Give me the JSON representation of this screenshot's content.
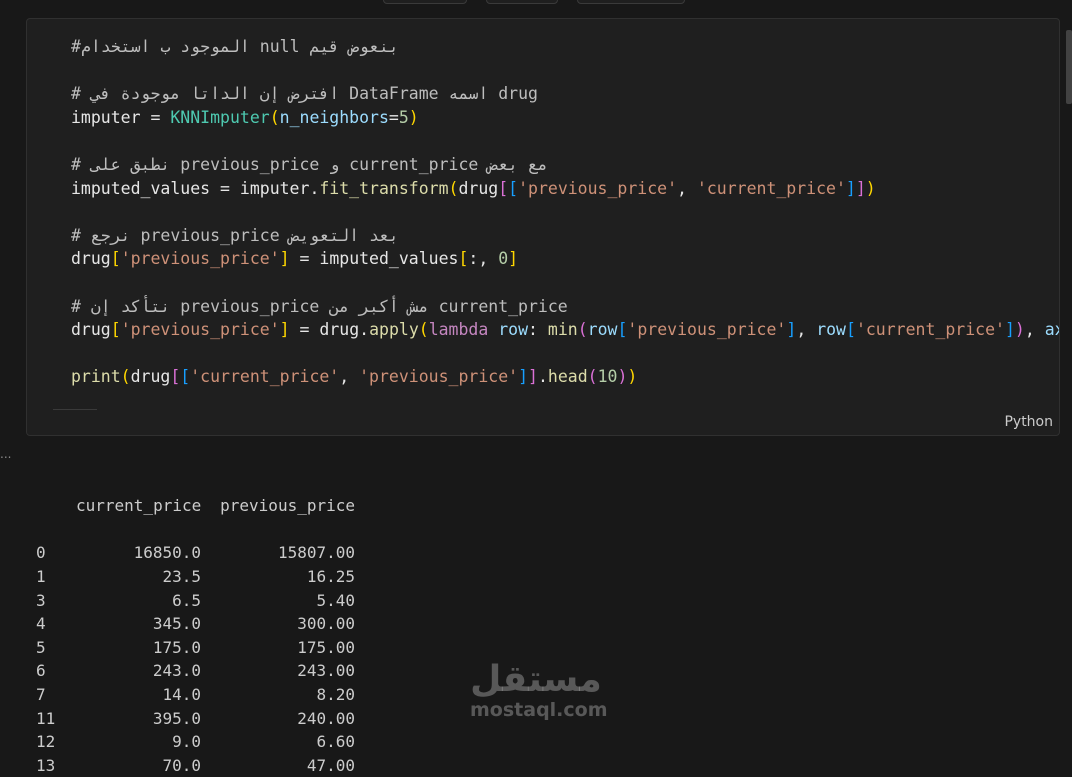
{
  "cell": {
    "language": "Python",
    "code_lines": [
      [
        {
          "t": "#الموجود ب استخدام null بنعوض قيم",
          "c": "cm"
        }
      ],
      [],
      [
        {
          "t": "# افترض إن الداتا موجودة في DataFrame اسمه drug",
          "c": "cm"
        }
      ],
      [
        {
          "t": "imputer",
          "c": "var"
        },
        {
          "t": " = ",
          "c": "var"
        },
        {
          "t": "KNNImputer",
          "c": "cls"
        },
        {
          "t": "(",
          "c": "b1"
        },
        {
          "t": "n_neighbors",
          "c": "par"
        },
        {
          "t": "=",
          "c": "var"
        },
        {
          "t": "5",
          "c": "num"
        },
        {
          "t": ")",
          "c": "b1"
        }
      ],
      [],
      [
        {
          "t": "# نطبق على previous_price و current_price مع بعض",
          "c": "cm"
        }
      ],
      [
        {
          "t": "imputed_values",
          "c": "var"
        },
        {
          "t": " = ",
          "c": "var"
        },
        {
          "t": "imputer",
          "c": "var"
        },
        {
          "t": ".",
          "c": "var"
        },
        {
          "t": "fit_transform",
          "c": "fn"
        },
        {
          "t": "(",
          "c": "b1"
        },
        {
          "t": "drug",
          "c": "var"
        },
        {
          "t": "[",
          "c": "b2"
        },
        {
          "t": "[",
          "c": "b3"
        },
        {
          "t": "'previous_price'",
          "c": "str"
        },
        {
          "t": ", ",
          "c": "var"
        },
        {
          "t": "'current_price'",
          "c": "str"
        },
        {
          "t": "]",
          "c": "b3"
        },
        {
          "t": "]",
          "c": "b2"
        },
        {
          "t": ")",
          "c": "b1"
        }
      ],
      [],
      [
        {
          "t": "# نرجع previous_price بعد التعويض",
          "c": "cm"
        }
      ],
      [
        {
          "t": "drug",
          "c": "var"
        },
        {
          "t": "[",
          "c": "b1"
        },
        {
          "t": "'previous_price'",
          "c": "str"
        },
        {
          "t": "]",
          "c": "b1"
        },
        {
          "t": " = ",
          "c": "var"
        },
        {
          "t": "imputed_values",
          "c": "var"
        },
        {
          "t": "[",
          "c": "b1"
        },
        {
          "t": ":, ",
          "c": "var"
        },
        {
          "t": "0",
          "c": "num"
        },
        {
          "t": "]",
          "c": "b1"
        }
      ],
      [],
      [
        {
          "t": "# نتأكد إن previous_price مش أكبر من current_price",
          "c": "cm"
        }
      ],
      [
        {
          "t": "drug",
          "c": "var"
        },
        {
          "t": "[",
          "c": "b1"
        },
        {
          "t": "'previous_price'",
          "c": "str"
        },
        {
          "t": "]",
          "c": "b1"
        },
        {
          "t": " = ",
          "c": "var"
        },
        {
          "t": "drug",
          "c": "var"
        },
        {
          "t": ".",
          "c": "var"
        },
        {
          "t": "apply",
          "c": "fn"
        },
        {
          "t": "(",
          "c": "b1"
        },
        {
          "t": "lambda",
          "c": "kw"
        },
        {
          "t": " ",
          "c": "var"
        },
        {
          "t": "row",
          "c": "par"
        },
        {
          "t": ": ",
          "c": "var"
        },
        {
          "t": "min",
          "c": "fn"
        },
        {
          "t": "(",
          "c": "b2"
        },
        {
          "t": "row",
          "c": "par"
        },
        {
          "t": "[",
          "c": "b3"
        },
        {
          "t": "'previous_price'",
          "c": "str"
        },
        {
          "t": "]",
          "c": "b3"
        },
        {
          "t": ", ",
          "c": "var"
        },
        {
          "t": "row",
          "c": "par"
        },
        {
          "t": "[",
          "c": "b3"
        },
        {
          "t": "'current_price'",
          "c": "str"
        },
        {
          "t": "]",
          "c": "b3"
        },
        {
          "t": ")",
          "c": "b2"
        },
        {
          "t": ", ",
          "c": "var"
        },
        {
          "t": "axis",
          "c": "par"
        },
        {
          "t": "=",
          "c": "var"
        }
      ],
      [],
      [
        {
          "t": "print",
          "c": "fn"
        },
        {
          "t": "(",
          "c": "b1"
        },
        {
          "t": "drug",
          "c": "var"
        },
        {
          "t": "[",
          "c": "b2"
        },
        {
          "t": "[",
          "c": "b3"
        },
        {
          "t": "'current_price'",
          "c": "str"
        },
        {
          "t": ", ",
          "c": "var"
        },
        {
          "t": "'previous_price'",
          "c": "str"
        },
        {
          "t": "]",
          "c": "b3"
        },
        {
          "t": "]",
          "c": "b2"
        },
        {
          "t": ".",
          "c": "var"
        },
        {
          "t": "head",
          "c": "fn"
        },
        {
          "t": "(",
          "c": "b2"
        },
        {
          "t": "10",
          "c": "num"
        },
        {
          "t": ")",
          "c": "b2"
        },
        {
          "t": ")",
          "c": "b1"
        }
      ]
    ]
  },
  "output": {
    "ellipsis": "...",
    "columns": [
      "current_price",
      "previous_price"
    ],
    "rows": [
      [
        "0",
        "16850.0",
        "15807.00"
      ],
      [
        "1",
        "23.5",
        "16.25"
      ],
      [
        "3",
        "6.5",
        "5.40"
      ],
      [
        "4",
        "345.0",
        "300.00"
      ],
      [
        "5",
        "175.0",
        "175.00"
      ],
      [
        "6",
        "243.0",
        "243.00"
      ],
      [
        "7",
        "14.0",
        "8.20"
      ],
      [
        "11",
        "395.0",
        "240.00"
      ],
      [
        "12",
        "9.0",
        "6.60"
      ],
      [
        "13",
        "70.0",
        "47.00"
      ]
    ]
  },
  "watermark": {
    "arabic": "مستقل",
    "latin": "mostaql.com"
  }
}
